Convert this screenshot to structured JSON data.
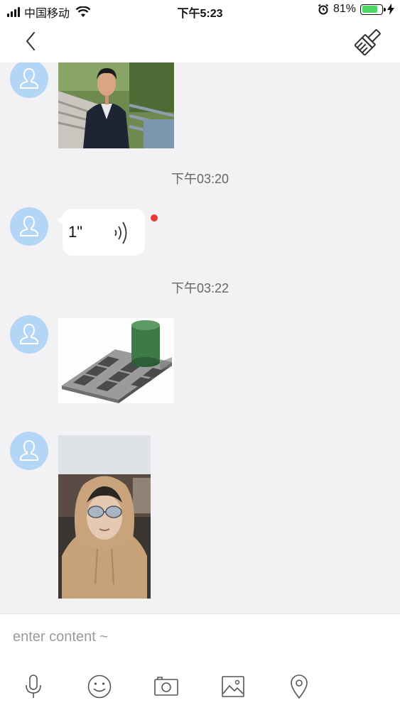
{
  "status_bar": {
    "carrier": "中国移动",
    "time": "下午5:23",
    "battery_percent": "81%",
    "battery_level": 0.81
  },
  "nav_bar": {
    "back_icon": "chevron-left-icon",
    "clean_icon": "broom-icon"
  },
  "messages": [
    {
      "type": "image",
      "sender_avatar": "user-avatar-icon",
      "content": "photo of man in dark jacket on outdoor walkway"
    },
    {
      "type": "timestamp",
      "text": "下午03:20"
    },
    {
      "type": "voice",
      "sender_avatar": "user-avatar-icon",
      "duration": "1\"",
      "unread": true
    },
    {
      "type": "timestamp",
      "text": "下午03:22"
    },
    {
      "type": "image",
      "sender_avatar": "user-avatar-icon",
      "content": "checkerboard with green cylinder illusion"
    },
    {
      "type": "image",
      "sender_avatar": "user-avatar-icon",
      "content": "person in hoodie and reflective sunglasses"
    }
  ],
  "input": {
    "placeholder": "enter content ~",
    "value": ""
  },
  "toolbar": {
    "items": [
      "microphone-icon",
      "emoji-icon",
      "camera-icon",
      "picture-icon",
      "location-icon"
    ]
  },
  "colors": {
    "avatar_bg": "#b3d5f6",
    "chat_bg": "#f2f2f5",
    "unread_dot": "#e53935",
    "battery": "#4cd964",
    "timestamp_text": "#666666"
  }
}
